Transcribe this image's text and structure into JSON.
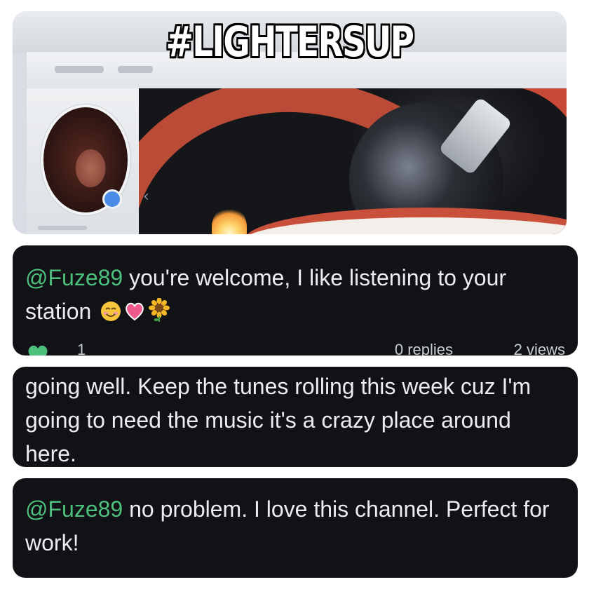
{
  "header": {
    "hashtag": "#LIGHTERSUP"
  },
  "comments": [
    {
      "mention": "@Fuze89",
      "body": " you're welcome, I like listening to your station",
      "emojis": [
        "smiling-face-with-blush",
        "heart",
        "sunflower"
      ],
      "likes": "1",
      "replies": "0 replies",
      "views": "2 views"
    },
    {
      "body": "going well. Keep the tunes rolling this week cuz I'm going to need the music it's a crazy place around here."
    },
    {
      "mention": "@Fuze89",
      "body": " no problem. I love this channel. Perfect for work!"
    }
  ],
  "colors": {
    "card_background": "#101216",
    "mention": "#4ec07d",
    "text": "#ebedf0",
    "like_heart": "#4ec07d"
  }
}
